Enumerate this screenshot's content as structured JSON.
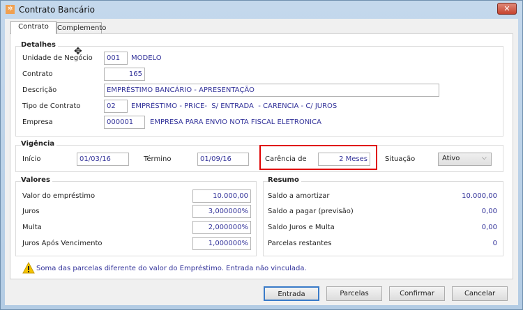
{
  "window": {
    "title": "Contrato Bancário",
    "close": "✕"
  },
  "tabs": [
    {
      "label": "Contrato"
    },
    {
      "label": "Complemento"
    }
  ],
  "detalhes": {
    "title": "Detalhes",
    "unidade_label": "Unidade de Negócio",
    "unidade_code": "001",
    "unidade_name": "MODELO",
    "contrato_label": "Contrato",
    "contrato_value": "165",
    "descricao_label": "Descrição",
    "descricao_value": "EMPRÉSTIMO BANCÁRIO - APRESENTAÇÃO",
    "tipo_label": "Tipo de Contrato",
    "tipo_code": "02",
    "tipo_name": "EMPRÉSTIMO - PRICE-  S/ ENTRADA  - CARENCIA - C/ JUROS",
    "empresa_label": "Empresa",
    "empresa_code": "000001",
    "empresa_name": "EMPRESA PARA ENVIO NOTA FISCAL ELETRONICA"
  },
  "vigencia": {
    "title": "Vigência",
    "inicio_label": "Início",
    "inicio": "01/03/16",
    "termino_label": "Término",
    "termino": "01/09/16",
    "carencia_label": "Carência de",
    "carencia": "2 Meses",
    "situacao_label": "Situação",
    "situacao": "Ativo"
  },
  "valores": {
    "title": "Valores",
    "rows": [
      {
        "label": "Valor do empréstimo",
        "value": "10.000,00"
      },
      {
        "label": "Juros",
        "value": "3,000000%"
      },
      {
        "label": "Multa",
        "value": "2,000000%"
      },
      {
        "label": "Juros Após Vencimento",
        "value": "1,000000%"
      }
    ]
  },
  "resumo": {
    "title": "Resumo",
    "rows": [
      {
        "label": "Saldo a amortizar",
        "value": "10.000,00"
      },
      {
        "label": "Saldo a pagar (previsão)",
        "value": "0,00"
      },
      {
        "label": "Saldo Juros e Multa",
        "value": "0,00"
      },
      {
        "label": "Parcelas restantes",
        "value": "0"
      }
    ]
  },
  "warning": "Soma das parcelas diferente do valor do Empréstimo. Entrada não vinculada.",
  "buttons": {
    "entrada": "Entrada",
    "parcelas": "Parcelas",
    "confirmar": "Confirmar",
    "cancelar": "Cancelar"
  },
  "colors": {
    "highlight": "#e00000",
    "value_text": "#33339a"
  }
}
